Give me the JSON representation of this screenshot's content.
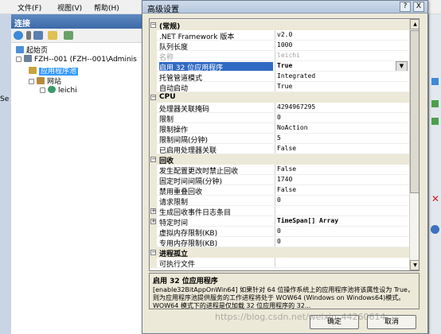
{
  "background_window": {
    "menu": [
      "文件(F)",
      "视图(V)",
      "帮助(H)"
    ],
    "connections_title": "连接",
    "tree": [
      {
        "label": "起始页"
      },
      {
        "label": "FZH--001 (FZH--001\\Adminis"
      },
      {
        "label": "应用程序池"
      },
      {
        "label": "网站"
      },
      {
        "label": "leichi"
      }
    ],
    "left_edge_text": "Se"
  },
  "dialog": {
    "title": "高级设置",
    "help_button": "?",
    "close_button": "X",
    "rows": [
      {
        "kind": "category",
        "label": "(常规)",
        "expander": "⊟"
      },
      {
        "kind": "prop",
        "name": ".NET Framework 版本",
        "value": "v2.0"
      },
      {
        "kind": "prop",
        "name": "队列长度",
        "value": "1000"
      },
      {
        "kind": "prop",
        "name": "名称",
        "value": "leichi",
        "disabled": true
      },
      {
        "kind": "prop",
        "name": "启用 32 位应用程序",
        "value": "True",
        "selected": true,
        "bold": true,
        "combo": true
      },
      {
        "kind": "prop",
        "name": "托管管道模式",
        "value": "Integrated"
      },
      {
        "kind": "prop",
        "name": "自动启动",
        "value": "True"
      },
      {
        "kind": "category",
        "label": "CPU",
        "expander": "⊟"
      },
      {
        "kind": "prop",
        "name": "处理器关联掩码",
        "value": "4294967295"
      },
      {
        "kind": "prop",
        "name": "限制",
        "value": "0"
      },
      {
        "kind": "prop",
        "name": "限制操作",
        "value": "NoAction"
      },
      {
        "kind": "prop",
        "name": "限制间隔(分钟)",
        "value": "5"
      },
      {
        "kind": "prop",
        "name": "已启用处理器关联",
        "value": "False"
      },
      {
        "kind": "category",
        "label": "回收",
        "expander": "⊟"
      },
      {
        "kind": "prop",
        "name": "发生配置更改时禁止回收",
        "value": "False"
      },
      {
        "kind": "prop",
        "name": "固定时间间隔(分钟)",
        "value": "1740"
      },
      {
        "kind": "prop",
        "name": "禁用重叠回收",
        "value": "False"
      },
      {
        "kind": "prop",
        "name": "请求限制",
        "value": "0"
      },
      {
        "kind": "prop",
        "name": "生成回收事件日志条目",
        "value": "",
        "expander": "⊞"
      },
      {
        "kind": "prop",
        "name": "特定时间",
        "value": "TimeSpan[] Array",
        "expander": "⊞",
        "bold": true
      },
      {
        "kind": "prop",
        "name": "虚拟内存限制(KB)",
        "value": "0"
      },
      {
        "kind": "prop",
        "name": "专用内存限制(KB)",
        "value": "0"
      },
      {
        "kind": "category",
        "label": "进程孤立",
        "expander": "⊟"
      },
      {
        "kind": "prop",
        "name": "可执行文件",
        "value": ""
      }
    ],
    "description": {
      "title": "启用 32 位应用程序",
      "text": "[enable32BitAppOnWin64] 如果针对 64 位操作系统上的应用程序池将该属性设为 True，则为应用程序池提供服务的工作进程将处于 WOW64 (Windows on Windows64)模式。WOW64 模式下的进程是仅加载 32 位应用程序的 32..."
    },
    "ok_button": "确定",
    "cancel_button": "取消"
  },
  "watermark": "https://blog.csdn.net/weixin_44260614"
}
